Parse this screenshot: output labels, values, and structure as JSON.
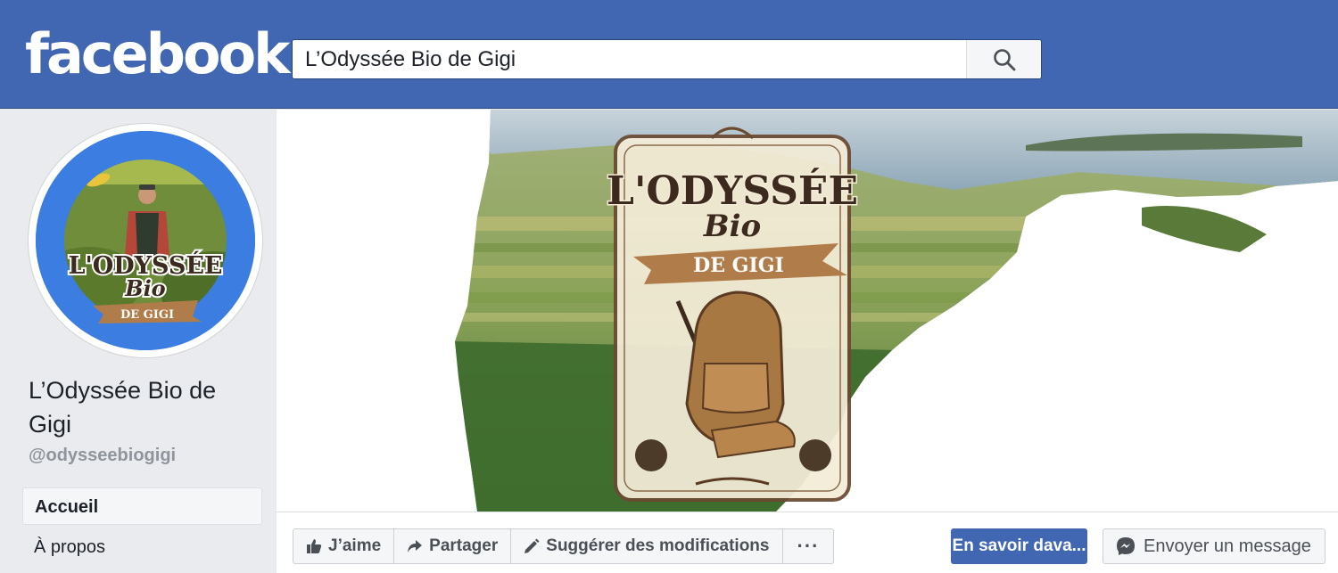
{
  "header": {
    "logo_text": "facebook",
    "search": {
      "value": "L’Odyssée Bio de Gigi",
      "icon": "search-icon"
    }
  },
  "sidebar": {
    "page_name": "L’Odyssée Bio de Gigi",
    "handle": "@odysseebiogigi",
    "nav": [
      {
        "label": "Accueil",
        "active": true
      },
      {
        "label": "À propos",
        "active": false
      }
    ]
  },
  "cover": {
    "logo_title": "L'ODYSSÉE",
    "logo_subtitle": "Bio",
    "logo_banner": "DE GIGI"
  },
  "avatar": {
    "logo_title": "L'ODYSSÉE",
    "logo_subtitle": "Bio",
    "logo_banner": "DE GIGI"
  },
  "actions": {
    "like": "J’aime",
    "share": "Partager",
    "suggest": "Suggérer des modifications",
    "more": "···",
    "learn_more": "En savoir dava...",
    "send_message": "Envoyer un message"
  },
  "colors": {
    "brand_blue": "#4267b2",
    "sidebar_bg": "#e9ebee",
    "avatar_ring": "#3b7de0"
  }
}
